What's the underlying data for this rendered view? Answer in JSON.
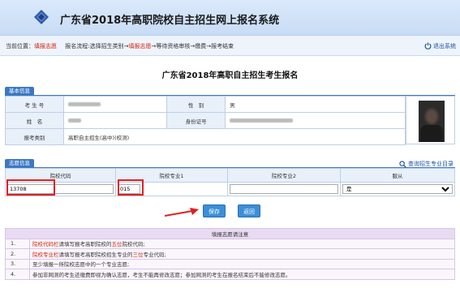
{
  "app": {
    "title": "广东省2018年高职院校自主招生网上报名系统"
  },
  "crumbbar": {
    "location_label": "当前位置：",
    "location_current": "填报志愿",
    "process_label": "报名流程:选择招生类别→",
    "process_current": "填报志愿",
    "process_rest": "→等待资格审核→缴费→报考结束",
    "logout_label": "退出系统"
  },
  "page_title": "广东省2018年高职自主招生考生报名",
  "basic": {
    "section_label": "基本信息",
    "rows": [
      {
        "l1": "考 生 号",
        "l2": "性　别",
        "v2": "男"
      },
      {
        "l1": "姓　名",
        "l2": "身份证号"
      },
      {
        "l1": "报考类别",
        "v1": "高职自主招生(高中)(校测)"
      }
    ]
  },
  "wish": {
    "section_label": "志愿信息",
    "query_label": "查询招生专业目录",
    "headers": [
      "院校代码",
      "院校专业1",
      "院校专业2",
      "服从"
    ],
    "school_code": "13708",
    "major1": "015",
    "major2": "",
    "obey_selected": "是"
  },
  "buttons": {
    "save": "保存",
    "back": "返回"
  },
  "notes": {
    "title": "填报志愿请注意",
    "items": [
      {
        "num": "1.",
        "a": "院校代码栏",
        "b": "请填写报考高职院校的",
        "c": "五位",
        "d": "院校代码;"
      },
      {
        "num": "2.",
        "a": "院校专业栏",
        "b": "请填写报考高职院校招生专业的",
        "c": "三位",
        "d": "专业代码;"
      },
      {
        "num": "3.",
        "text": "至少填报一所院校志愿中的一个专业志愿;"
      },
      {
        "num": "4.",
        "text": "参加非网测的考生还缴费即视为确认志愿，考生不能再修改志愿；参加网测的考生在报名结束后不能修改志愿。"
      }
    ]
  },
  "colors": {
    "accent": "#3b78c3",
    "highlight": "#e02020",
    "alert": "#d81e06"
  },
  "icons": {
    "logo": "logo-diamond-icon",
    "logout": "power-icon",
    "query": "search-icon",
    "arrow": "red-arrow-icon"
  }
}
